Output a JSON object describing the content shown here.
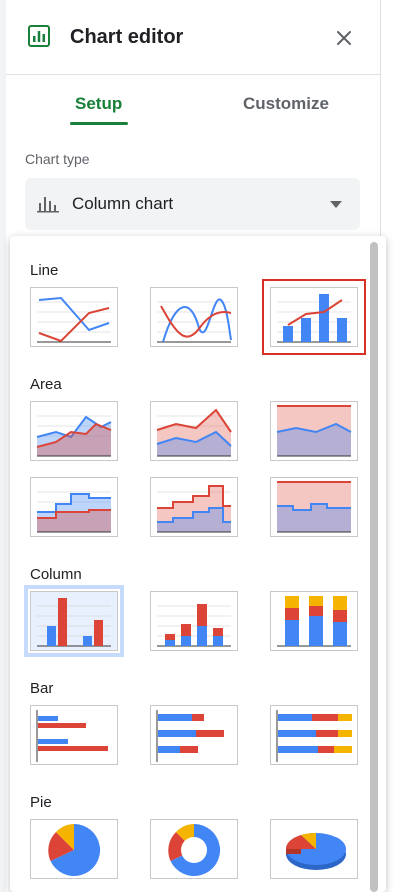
{
  "header": {
    "title": "Chart editor",
    "logo_icon": "chart-logo-icon",
    "close_icon": "close-icon"
  },
  "tabs": [
    {
      "label": "Setup",
      "active": true
    },
    {
      "label": "Customize",
      "active": false
    }
  ],
  "chart_type": {
    "label": "Chart type",
    "selected": "Column chart",
    "icon": "column-chart-icon",
    "caret_icon": "caret-down-icon"
  },
  "sections": [
    {
      "label": "Line",
      "thumbs": [
        "line-chart",
        "smooth-line-chart",
        "combo-chart"
      ]
    },
    {
      "label": "Area",
      "thumbs": [
        "area-chart",
        "stacked-area-chart",
        "100-stacked-area-chart",
        "stepped-area-chart",
        "stacked-stepped-area-chart",
        "100-stacked-stepped-area-chart"
      ]
    },
    {
      "label": "Column",
      "thumbs": [
        "column-chart",
        "stacked-column-chart",
        "100-stacked-column-chart"
      ]
    },
    {
      "label": "Bar",
      "thumbs": [
        "bar-chart",
        "stacked-bar-chart",
        "100-stacked-bar-chart"
      ]
    },
    {
      "label": "Pie",
      "thumbs": [
        "pie-chart",
        "doughnut-chart",
        "3d-pie-chart"
      ]
    }
  ],
  "colors": {
    "accent_green": "#188038",
    "blue": "#4285f4",
    "red": "#db4437",
    "yellow": "#f4b400",
    "highlight_red": "#d93025"
  }
}
